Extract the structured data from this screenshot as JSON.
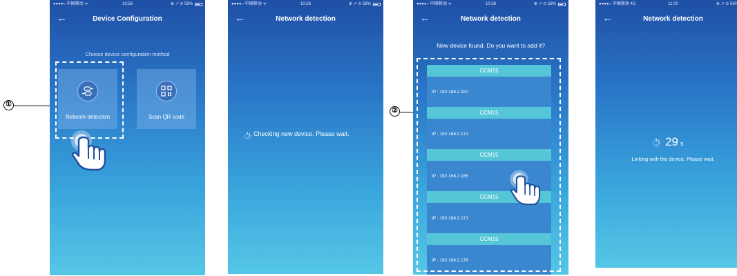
{
  "status_bars": [
    {
      "carrier": "●●●●○ 中国移动 ᯤ",
      "time": "10:58",
      "right": "⊕ ↗ ⊙ 58%"
    },
    {
      "carrier": "●●●●○ 中国移动 ᯤ",
      "time": "10:58",
      "right": "⊕ ↗ ⊙ 58%"
    },
    {
      "carrier": "●●●●○ 中国移动 ᯤ",
      "time": "10:58",
      "right": "⊕ ↗ ⊙ 58%"
    },
    {
      "carrier": "●●●●○ 中国移动 4G",
      "time": "11:00",
      "right": "⊕ ↗ ⊙ 56%"
    }
  ],
  "screen1": {
    "title": "Device Configuration",
    "choose_text": "Choose device configuration method",
    "option_network": "Network detection",
    "option_qr": "Scan QR code"
  },
  "screen2": {
    "title": "Network detection",
    "checking_text": "Checking new device. Please wait."
  },
  "screen3": {
    "title": "Network detection",
    "found_text": "New device found. Do you want to add it?",
    "devices": [
      {
        "name": "CCM15",
        "ip": "IP : 192.168.2.157"
      },
      {
        "name": "CCM15",
        "ip": "IP : 192.168.2.172"
      },
      {
        "name": "CCM15",
        "ip": "IP : 192.168.2.165"
      },
      {
        "name": "CCM15",
        "ip": "IP : 192.168.2.171"
      },
      {
        "name": "CCM15",
        "ip": "IP : 192.168.2.176"
      }
    ]
  },
  "screen4": {
    "title": "Network detection",
    "countdown": "29",
    "unit": "s",
    "linking_text": "Linking with the device. Please wait."
  },
  "callouts": {
    "one": "①",
    "two": "②"
  },
  "colors": {
    "header_blue": "#1f4fa6",
    "bottom_cyan": "#55c7e6",
    "device_header": "#55c6d8",
    "device_row": "#3a86cf"
  }
}
